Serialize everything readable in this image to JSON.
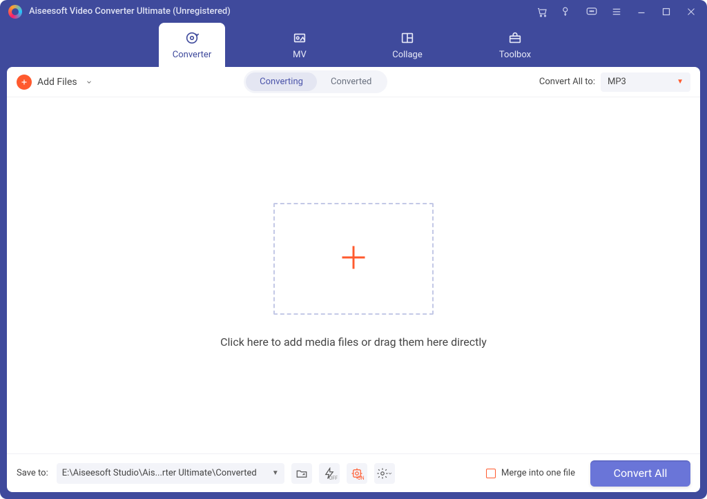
{
  "title": "Aiseesoft Video Converter Ultimate (Unregistered)",
  "mainTabs": {
    "converter": "Converter",
    "mv": "MV",
    "collage": "Collage",
    "toolbox": "Toolbox"
  },
  "toolbar": {
    "addFiles": "Add Files",
    "segment": {
      "converting": "Converting",
      "converted": "Converted"
    },
    "convertAllTo": "Convert All to:",
    "selectedFormat": "MP3"
  },
  "dropArea": {
    "hint": "Click here to add media files or drag them here directly"
  },
  "bottom": {
    "saveTo": "Save to:",
    "path": "E:\\Aiseesoft Studio\\Ais...rter Ultimate\\Converted",
    "flashState": "OFF",
    "gpuState": "ON",
    "merge": "Merge into one file",
    "convertAll": "Convert All"
  }
}
